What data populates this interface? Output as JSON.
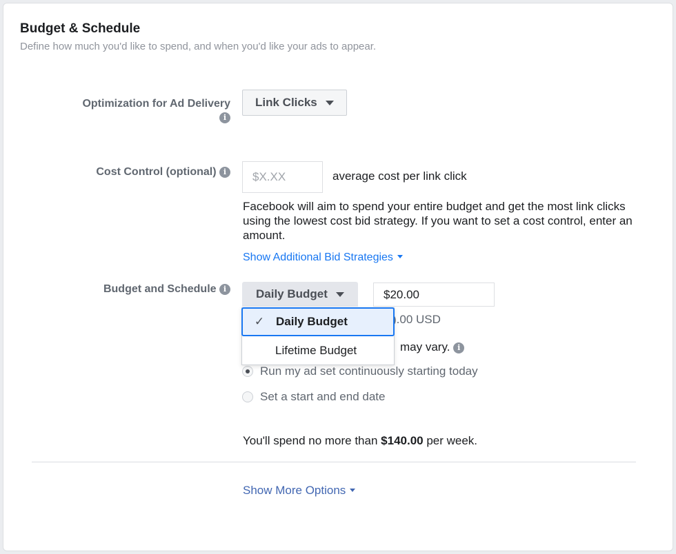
{
  "section": {
    "title": "Budget & Schedule",
    "subtitle": "Define how much you'd like to spend, and when you'd like your ads to appear."
  },
  "optimization": {
    "label": "Optimization for Ad Delivery",
    "value": "Link Clicks",
    "info_icon": "info-icon"
  },
  "cost_control": {
    "label": "Cost Control (optional)",
    "placeholder": "$X.XX",
    "value": "",
    "suffix": "average cost per link click",
    "description": "Facebook will aim to spend your entire budget and get the most link clicks using the lowest cost bid strategy. If you want to set a cost control, enter an amount.",
    "link": "Show Additional Bid Strategies"
  },
  "budget": {
    "label": "Budget and Schedule",
    "type_selected": "Daily Budget",
    "amount": "$20.00",
    "partial_amount_text": ").00 USD",
    "partial_vary_text": "may vary.",
    "dropdown_options": [
      {
        "label": "Daily Budget",
        "selected": true
      },
      {
        "label": "Lifetime Budget",
        "selected": false
      }
    ],
    "schedule_options": [
      {
        "label": "Run my ad set continuously starting today",
        "checked": true
      },
      {
        "label": "Set a start and end date",
        "checked": false
      }
    ],
    "summary_prefix": "You'll spend no more than ",
    "summary_amount": "$140.00",
    "summary_suffix": " per week."
  },
  "footer": {
    "more_options_link": "Show More Options"
  },
  "colors": {
    "link": "#1877f2",
    "link_dark": "#4267b2",
    "selected_bg": "#e7f0fd"
  }
}
